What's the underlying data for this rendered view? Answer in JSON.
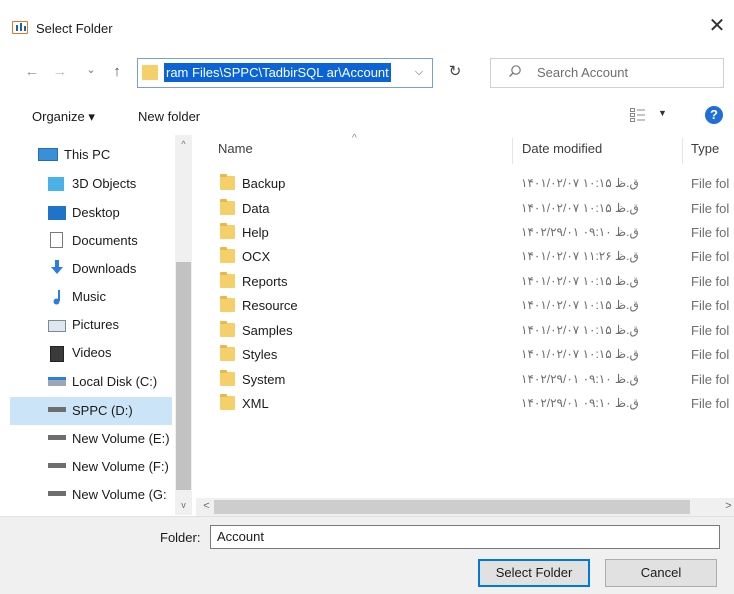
{
  "window": {
    "title": "Select Folder",
    "close_glyph": "✕"
  },
  "nav": {
    "back_glyph": "←",
    "forward_glyph": "→",
    "recent_glyph": "⌄",
    "up_glyph": "↑",
    "address_path": "ram Files\\SPPC\\TadbirSQL ar\\Account",
    "address_chevron": "⌵",
    "refresh_glyph": "↻",
    "search_placeholder": "Search Account"
  },
  "toolbar": {
    "organize_label": "Organize ▾",
    "new_folder_label": "New folder",
    "view_caret": "▼",
    "help_glyph": "?"
  },
  "sidebar": {
    "items": [
      {
        "label": "This PC",
        "icon": "computer-icon"
      },
      {
        "label": "3D Objects",
        "icon": "cube-icon"
      },
      {
        "label": "Desktop",
        "icon": "desktop-icon"
      },
      {
        "label": "Documents",
        "icon": "document-icon"
      },
      {
        "label": "Downloads",
        "icon": "download-arrow-icon"
      },
      {
        "label": "Music",
        "icon": "music-note-icon"
      },
      {
        "label": "Pictures",
        "icon": "picture-icon"
      },
      {
        "label": "Videos",
        "icon": "film-icon"
      },
      {
        "label": "Local Disk (C:)",
        "icon": "drive-windows-icon"
      },
      {
        "label": "SPPC (D:)",
        "icon": "drive-icon",
        "selected": true
      },
      {
        "label": "New Volume (E:)",
        "icon": "drive-icon"
      },
      {
        "label": "New Volume (F:)",
        "icon": "drive-icon"
      },
      {
        "label": "New Volume (G:",
        "icon": "drive-icon"
      }
    ]
  },
  "columns": {
    "name": "Name",
    "date_modified": "Date modified",
    "type": "Type",
    "sort_caret": "^"
  },
  "files": [
    {
      "name": "Backup",
      "date": "۱۴۰۱/۰۲/۰۷ ق.ظ ۱۰:۱۵",
      "type": "File fol"
    },
    {
      "name": "Data",
      "date": "۱۴۰۱/۰۲/۰۷ ق.ظ ۱۰:۱۵",
      "type": "File fol"
    },
    {
      "name": "Help",
      "date": "۱۴۰۲/۲۹/۰۱ ق.ظ ۰۹:۱۰",
      "type": "File fol"
    },
    {
      "name": "OCX",
      "date": "۱۴۰۱/۰۲/۰۷ ق.ظ ۱۱:۲۶",
      "type": "File fol"
    },
    {
      "name": "Reports",
      "date": "۱۴۰۱/۰۲/۰۷ ق.ظ ۱۰:۱۵",
      "type": "File fol"
    },
    {
      "name": "Resource",
      "date": "۱۴۰۱/۰۲/۰۷ ق.ظ ۱۰:۱۵",
      "type": "File fol"
    },
    {
      "name": "Samples",
      "date": "۱۴۰۱/۰۲/۰۷ ق.ظ ۱۰:۱۵",
      "type": "File fol"
    },
    {
      "name": "Styles",
      "date": "۱۴۰۱/۰۲/۰۷ ق.ظ ۱۰:۱۵",
      "type": "File fol"
    },
    {
      "name": "System",
      "date": "۱۴۰۲/۲۹/۰۱ ق.ظ ۰۹:۱۰",
      "type": "File fol"
    },
    {
      "name": "XML",
      "date": "۱۴۰۲/۲۹/۰۱ ق.ظ ۰۹:۱۰",
      "type": "File fol"
    }
  ],
  "scroll": {
    "up_glyph": "^",
    "down_glyph": "v",
    "left_glyph": "<",
    "right_glyph": ">"
  },
  "footer": {
    "folder_label": "Folder:",
    "folder_value": "Account",
    "select_button": "Select Folder",
    "cancel_button": "Cancel"
  },
  "colors": {
    "selection": "#0a64d6",
    "nav_selected_bg": "#cce4f7",
    "folder_yellow": "#f5cf6a",
    "help_blue": "#1f6fd6"
  }
}
